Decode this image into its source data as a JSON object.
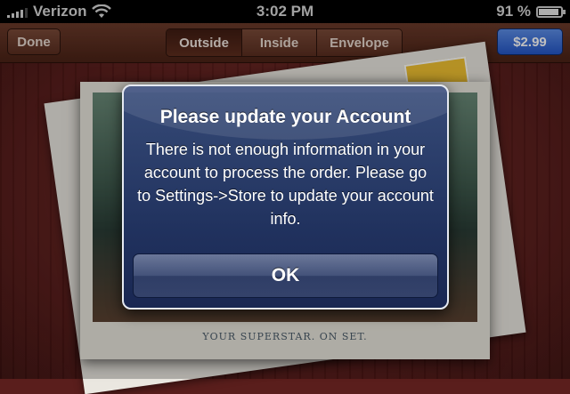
{
  "status_bar": {
    "carrier": "Verizon",
    "time": "3:02 PM",
    "battery_percent": "91 %",
    "battery_level": 0.91,
    "icons": [
      "signal-icon",
      "wifi-icon",
      "battery-icon"
    ]
  },
  "toolbar": {
    "done_label": "Done",
    "segments": [
      {
        "label": "Outside",
        "selected": true
      },
      {
        "label": "Inside",
        "selected": false
      },
      {
        "label": "Envelope",
        "selected": false
      }
    ],
    "price_label": "$2.99",
    "price_color": "#2f63d4"
  },
  "card": {
    "caption": "YOUR SUPERSTAR. ON SET."
  },
  "alert": {
    "title": "Please update your Account",
    "message": "There is not enough information in your account to process the order. Please go to Settings->Store to update your account info.",
    "ok_label": "OK"
  }
}
